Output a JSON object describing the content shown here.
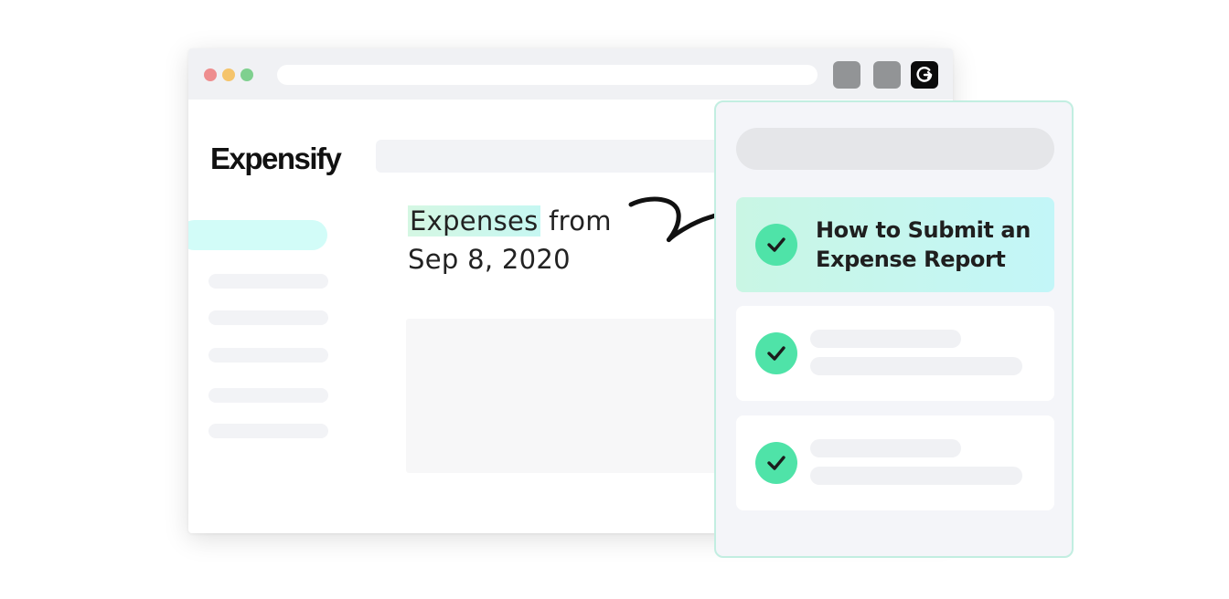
{
  "colors": {
    "red": "#ee8d8e",
    "yellow": "#f5c46b",
    "green": "#7fd08f",
    "highlight": "#c6f7f2",
    "check": "#4fe3a8",
    "panel_border": "#c2eee1"
  },
  "browser": {
    "extensions": [
      "extension-button",
      "extension-button",
      "g-logo-icon"
    ]
  },
  "app": {
    "logo": "Expensify"
  },
  "document": {
    "highlighted_word": "Expenses",
    "line1_rest": " from",
    "line2": "Sep 8, 2020"
  },
  "panel": {
    "cards": [
      {
        "title_line1": "How to Submit an",
        "title_line2": "Expense Report",
        "icon": "check-icon",
        "active": true
      },
      {
        "icon": "check-icon",
        "active": false
      },
      {
        "icon": "check-icon",
        "active": false
      }
    ]
  }
}
